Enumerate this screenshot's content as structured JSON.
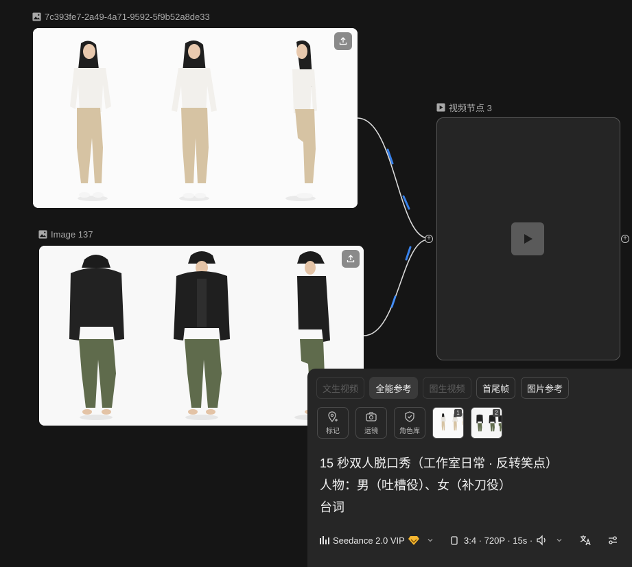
{
  "nodes": {
    "image_node_1": {
      "label": "7c393fe7-2a49-4a71-9592-5f9b52a8de33"
    },
    "image_node_2": {
      "label": "Image 137"
    },
    "video_node": {
      "label": "视频节点 3"
    }
  },
  "panel": {
    "tabs": [
      {
        "label": "文生视频",
        "state": "disabled"
      },
      {
        "label": "全能参考",
        "state": "active"
      },
      {
        "label": "图生视频",
        "state": "disabled"
      },
      {
        "label": "首尾帧",
        "state": "normal"
      },
      {
        "label": "图片参考",
        "state": "normal"
      }
    ],
    "tools": [
      {
        "label": "标记",
        "icon": "location-pin-plus-icon"
      },
      {
        "label": "运镜",
        "icon": "camera-icon"
      },
      {
        "label": "角色库",
        "icon": "shield-check-icon"
      }
    ],
    "reference_badges": [
      "1",
      "2"
    ],
    "prompt": {
      "line1": "15 秒双人脱口秀（工作室日常 · 反转笑点）",
      "line2": "人物：男（吐槽役）、女（补刀役）",
      "line3": "台词"
    },
    "model": {
      "name": "Seedance 2.0 VIP",
      "badge_color": "#f5b731"
    },
    "settings": {
      "summary": "3:4 · 720P · 15s ·"
    }
  },
  "colors": {
    "canvas_bg": "#151515",
    "panel_bg": "#262626",
    "edge": "#d9d9d9",
    "edge_glow": "#3b8cff"
  }
}
